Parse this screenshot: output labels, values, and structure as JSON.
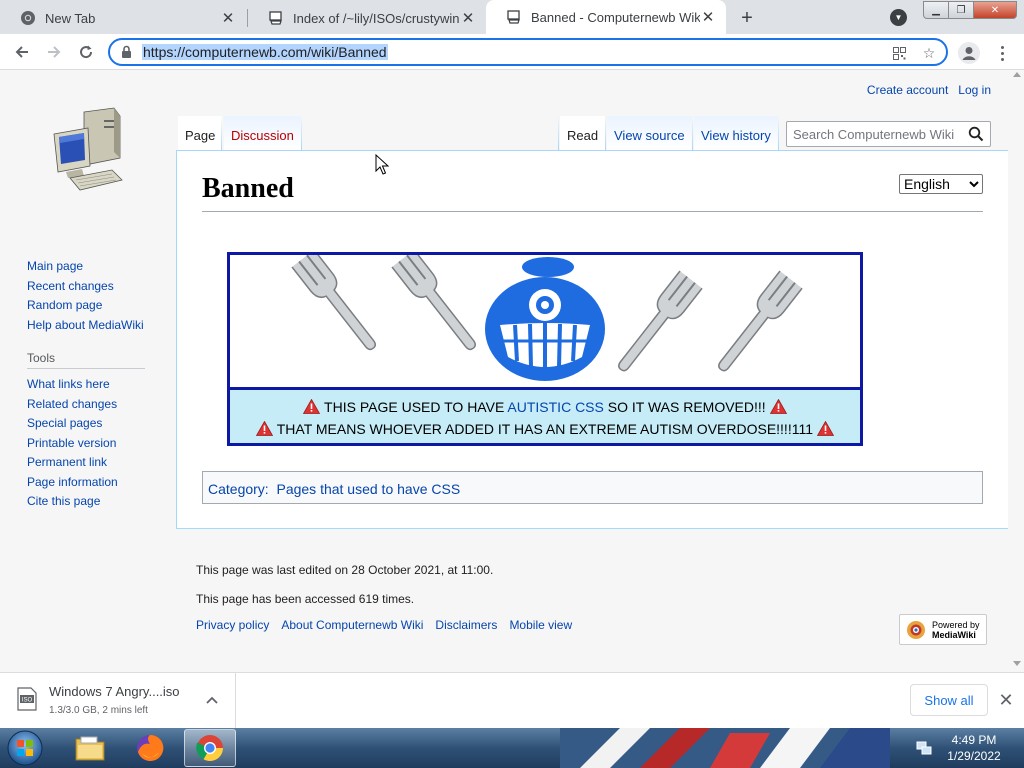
{
  "browser": {
    "tabs": [
      {
        "title": "New Tab"
      },
      {
        "title": "Index of /~lily/ISOs/crustywindo"
      },
      {
        "title": "Banned - Computernewb Wiki"
      }
    ],
    "url": "https://computernewb.com/wiki/Banned"
  },
  "wiki": {
    "personal": {
      "create_account": "Create account",
      "login": "Log in"
    },
    "tabs": {
      "page": "Page",
      "discussion": "Discussion",
      "read": "Read",
      "view_source": "View source",
      "view_history": "View history"
    },
    "search_placeholder": "Search Computernewb Wiki",
    "title": "Banned",
    "language": "English",
    "sidebar": {
      "nav": [
        "Main page",
        "Recent changes",
        "Random page",
        "Help about MediaWiki"
      ],
      "tools_heading": "Tools",
      "tools": [
        "What links here",
        "Related changes",
        "Special pages",
        "Printable version",
        "Permanent link",
        "Page information",
        "Cite this page"
      ]
    },
    "banner": {
      "line1_pre": "THIS PAGE USED TO HAVE",
      "line1_link": "AUTISTIC CSS",
      "line1_post": "SO IT WAS REMOVED!!!",
      "line2": "THAT MEANS WHOEVER ADDED IT HAS AN EXTREME AUTISM OVERDOSE!!!!111"
    },
    "category": {
      "label": "Category:",
      "link": "Pages that used to have CSS"
    },
    "footer": {
      "last_edited": "This page was last edited on 28 October 2021, at 11:00.",
      "accessed": "This page has been accessed 619 times.",
      "links": [
        "Privacy policy",
        "About Computernewb Wiki",
        "Disclaimers",
        "Mobile view"
      ],
      "powered_by": "Powered by",
      "mediawiki": "MediaWiki"
    }
  },
  "downloads": {
    "file": "Windows 7 Angry....iso",
    "status": "1.3/3.0 GB, 2 mins left",
    "show_all": "Show all"
  },
  "taskbar": {
    "time": "4:49 PM",
    "date": "1/29/2022"
  }
}
